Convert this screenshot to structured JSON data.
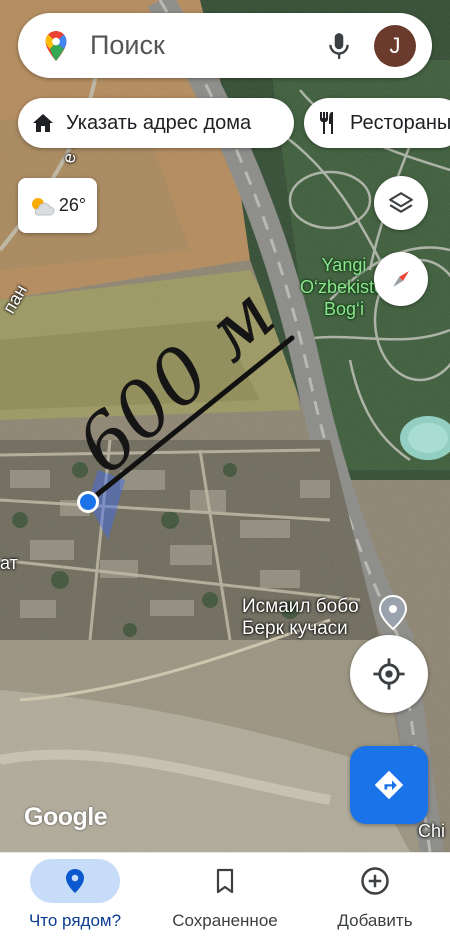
{
  "search": {
    "placeholder": "Поиск",
    "avatar_letter": "J"
  },
  "chips": [
    {
      "label": "Указать адрес дома",
      "icon": "home-icon"
    },
    {
      "label": "Рестораны",
      "icon": "restaurant-icon"
    }
  ],
  "weather": {
    "temperature": "26°",
    "icon": "partly-cloudy-icon"
  },
  "map_labels": {
    "park": [
      "Yangi",
      "O‘zbekiston",
      "Bog‘i"
    ],
    "street": [
      "Исмаил бобо",
      "Берк кучаси"
    ],
    "edge_left_top": "пан",
    "edge_left_mid": "ат",
    "edge_road_top": "е ч",
    "edge_right_bottom": "Chi"
  },
  "annotation": {
    "handwritten": "600 м"
  },
  "attribution": "Google",
  "bottom_nav": [
    {
      "label": "Что рядом?",
      "icon": "explore-pin-icon",
      "selected": true
    },
    {
      "label": "Сохраненное",
      "icon": "bookmark-icon",
      "selected": false
    },
    {
      "label": "Добавить",
      "icon": "add-circle-icon",
      "selected": false
    }
  ],
  "colors": {
    "accent": "#1a73e8",
    "selected_tab": "#c6dcf9",
    "park_label": "#8ee58f"
  }
}
